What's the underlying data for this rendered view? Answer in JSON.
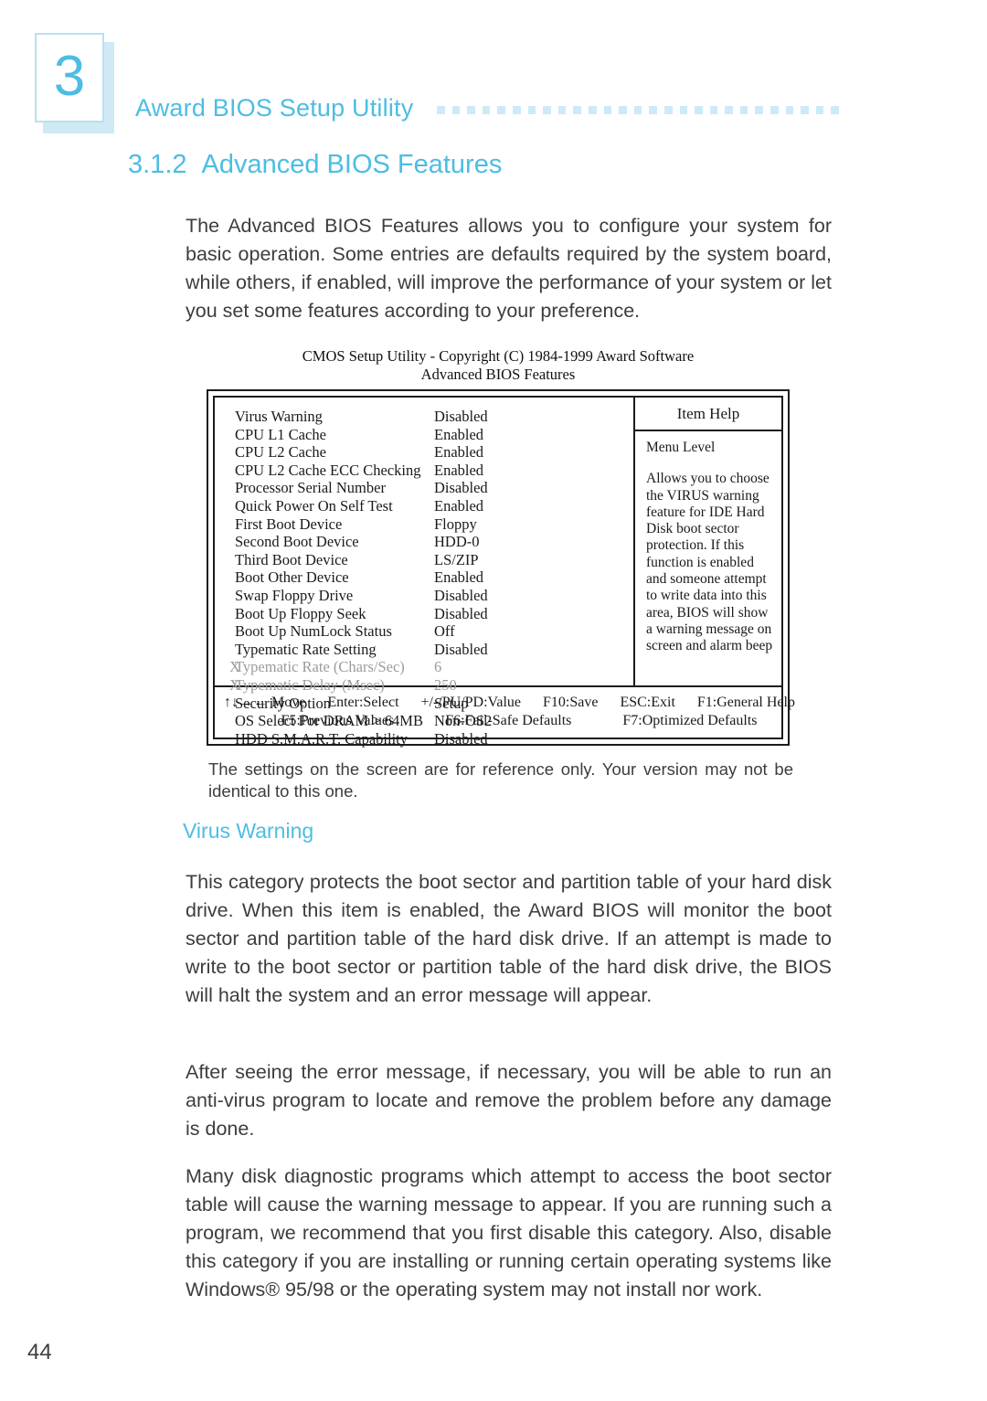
{
  "chapter": {
    "number": "3",
    "title": "Award BIOS Setup Utility",
    "dot_count": 27,
    "accent_color": "#4cbde3",
    "dot_color": "#cdeaf7"
  },
  "section": {
    "number": "3.1.2",
    "title": "Advanced BIOS Features"
  },
  "intro_paragraph": "The Advanced BIOS Features allows you to configure your system for basic operation. Some entries are defaults required by the system board, while others, if enabled, will improve the performance of your system or let you set some features according to your preference.",
  "figure": {
    "caption_line_1": "CMOS Setup Utility - Copyright (C) 1984-1999 Award Software",
    "caption_line_2": "Advanced BIOS Features",
    "help_title": "Item Help",
    "help_menu_level": "Menu Level",
    "help_text": "Allows you to choose the VIRUS warning feature for IDE Hard Disk boot sector protection. If this function is enabled and someone attempt to write data into this area, BIOS will show a warning message on screen and alarm beep",
    "rows": [
      {
        "mark": "",
        "label": "Virus Warning",
        "value": "Disabled",
        "dim": false
      },
      {
        "mark": "",
        "label": "CPU L1 Cache",
        "value": "Enabled",
        "dim": false
      },
      {
        "mark": "",
        "label": "CPU L2 Cache",
        "value": "Enabled",
        "dim": false
      },
      {
        "mark": "",
        "label": "CPU L2 Cache ECC Checking",
        "value": "Enabled",
        "dim": false
      },
      {
        "mark": "",
        "label": "Processor Serial Number",
        "value": "Disabled",
        "dim": false
      },
      {
        "mark": "",
        "label": "Quick Power On Self Test",
        "value": "Enabled",
        "dim": false
      },
      {
        "mark": "",
        "label": "First Boot Device",
        "value": "Floppy",
        "dim": false
      },
      {
        "mark": "",
        "label": "Second Boot Device",
        "value": "HDD-0",
        "dim": false
      },
      {
        "mark": "",
        "label": "Third Boot Device",
        "value": "LS/ZIP",
        "dim": false
      },
      {
        "mark": "",
        "label": "Boot Other Device",
        "value": "Enabled",
        "dim": false
      },
      {
        "mark": "",
        "label": "Swap Floppy Drive",
        "value": "Disabled",
        "dim": false
      },
      {
        "mark": "",
        "label": "Boot Up Floppy Seek",
        "value": "Disabled",
        "dim": false
      },
      {
        "mark": "",
        "label": "Boot Up NumLock Status",
        "value": "Off",
        "dim": false
      },
      {
        "mark": "",
        "label": "Typematic Rate Setting",
        "value": "Disabled",
        "dim": false
      },
      {
        "mark": "X",
        "label": "Typematic Rate (Chars/Sec)",
        "value": "6",
        "dim": true
      },
      {
        "mark": "X",
        "label": "Typematic Delay (Msec)",
        "value": "250",
        "dim": true
      },
      {
        "mark": "",
        "label": "Security Option",
        "value": "Setup",
        "dim": false
      },
      {
        "mark": "",
        "label": "OS Select For DRAM > 64MB",
        "value": "Non-OS2",
        "dim": false
      },
      {
        "mark": "",
        "label": "HDD S.M.A.R.T. Capability",
        "value": "Disabled",
        "dim": false
      }
    ],
    "footer_line_1": [
      "↑↓→← Move",
      "Enter:Select",
      "+/-/PU/PD:Value",
      "F10:Save",
      "ESC:Exit",
      "F1:General Help"
    ],
    "footer_line_2": [
      "F5:Previous Values",
      "F6:Fail-Safe Defaults",
      "F7:Optimized Defaults"
    ]
  },
  "figure_caption": "The settings on the screen are for reference only. Your version may not be identical to this one.",
  "subsection": {
    "title": "Virus Warning"
  },
  "paragraphs": [
    "This category protects the boot sector and partition table of your hard disk drive. When this item is enabled, the Award BIOS will monitor the boot sector and partition table of the hard disk drive. If an attempt is made to write to the boot sector or partition table of the hard disk drive, the BIOS will halt the system and an error message will appear.",
    "After seeing the error message, if necessary, you will be able to run an anti-virus program to locate and remove the problem before any damage is done.",
    "Many disk diagnostic programs which attempt to access the boot sector table will cause the warning message to appear. If you are running such a program, we recommend that you first disable this category. Also, disable this category if you are installing or running certain operating systems like Windows® 95/98 or the operating system may not install nor work."
  ],
  "page_number": "44"
}
